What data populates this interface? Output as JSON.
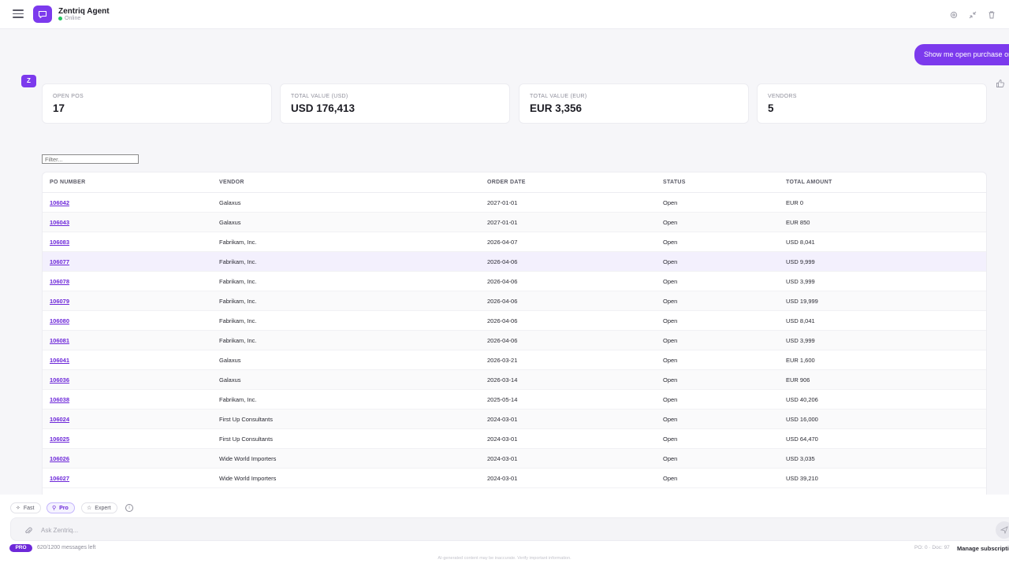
{
  "header": {
    "title": "Zentriq Agent",
    "status": "Online"
  },
  "chat": {
    "user_message": "Show me open purchase orders",
    "agent_avatar_letter": "Z"
  },
  "kpis": [
    {
      "label": "OPEN POS",
      "value": "17"
    },
    {
      "label": "TOTAL VALUE (USD)",
      "value": "USD 176,413"
    },
    {
      "label": "TOTAL VALUE (EUR)",
      "value": "EUR 3,356"
    },
    {
      "label": "VENDORS",
      "value": "5"
    }
  ],
  "filter": {
    "placeholder": "Filter..."
  },
  "table": {
    "columns": [
      "PO NUMBER",
      "VENDOR",
      "ORDER DATE",
      "STATUS",
      "TOTAL AMOUNT"
    ],
    "rows": [
      {
        "po": "106042",
        "vendor": "Galaxus",
        "date": "2027-01-01",
        "status": "Open",
        "amount": "EUR 0"
      },
      {
        "po": "106043",
        "vendor": "Galaxus",
        "date": "2027-01-01",
        "status": "Open",
        "amount": "EUR 850"
      },
      {
        "po": "106083",
        "vendor": "Fabrikam, Inc.",
        "date": "2026-04-07",
        "status": "Open",
        "amount": "USD 8,041"
      },
      {
        "po": "106077",
        "vendor": "Fabrikam, Inc.",
        "date": "2026-04-06",
        "status": "Open",
        "amount": "USD 9,999"
      },
      {
        "po": "106078",
        "vendor": "Fabrikam, Inc.",
        "date": "2026-04-06",
        "status": "Open",
        "amount": "USD 3,999"
      },
      {
        "po": "106079",
        "vendor": "Fabrikam, Inc.",
        "date": "2026-04-06",
        "status": "Open",
        "amount": "USD 19,999"
      },
      {
        "po": "106080",
        "vendor": "Fabrikam, Inc.",
        "date": "2026-04-06",
        "status": "Open",
        "amount": "USD 8,041"
      },
      {
        "po": "106081",
        "vendor": "Fabrikam, Inc.",
        "date": "2026-04-06",
        "status": "Open",
        "amount": "USD 3,999"
      },
      {
        "po": "106041",
        "vendor": "Galaxus",
        "date": "2026-03-21",
        "status": "Open",
        "amount": "EUR 1,600"
      },
      {
        "po": "106036",
        "vendor": "Galaxus",
        "date": "2026-03-14",
        "status": "Open",
        "amount": "EUR 906"
      },
      {
        "po": "106038",
        "vendor": "Fabrikam, Inc.",
        "date": "2025-05-14",
        "status": "Open",
        "amount": "USD 40,206"
      },
      {
        "po": "106024",
        "vendor": "First Up Consultants",
        "date": "2024-03-01",
        "status": "Open",
        "amount": "USD 16,000"
      },
      {
        "po": "106025",
        "vendor": "First Up Consultants",
        "date": "2024-03-01",
        "status": "Open",
        "amount": "USD 64,470"
      },
      {
        "po": "106026",
        "vendor": "Wide World Importers",
        "date": "2024-03-01",
        "status": "Open",
        "amount": "USD 3,035"
      },
      {
        "po": "106027",
        "vendor": "Wide World Importers",
        "date": "2024-03-01",
        "status": "Open",
        "amount": "USD 39,210"
      }
    ]
  },
  "modes": {
    "fast": "Fast",
    "pro": "Pro",
    "expert": "Expert",
    "selected": "Pro"
  },
  "input": {
    "placeholder": "Ask Zentriq..."
  },
  "footer": {
    "plan_badge": "PRO",
    "messages_left": "620/1200 messages left",
    "disclaimer": "AI-generated content may be inaccurate. Verify important information.",
    "po_doc": "PO: 0 · Doc: 97",
    "manage": "Manage subscription"
  },
  "colors": {
    "accent": "#7c3aed",
    "link": "#6d28d9",
    "online": "#22c55e"
  }
}
